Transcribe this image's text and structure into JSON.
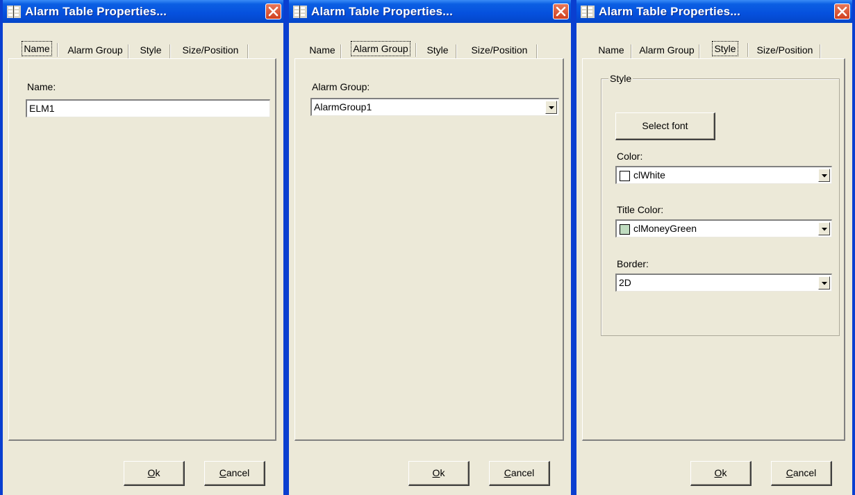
{
  "windows": [
    {
      "title": "Alarm Table Properties...",
      "tabs": [
        {
          "label": "Name"
        },
        {
          "label": "Alarm Group"
        },
        {
          "label": "Style"
        },
        {
          "label": "Size/Position"
        }
      ],
      "active_tab": "Name",
      "name_label": "Name:",
      "name_value": "ELM1",
      "ok_label": "Ok",
      "ok_mnemonic": "O",
      "cancel_label": "Cancel",
      "cancel_mnemonic": "C"
    },
    {
      "title": "Alarm Table Properties...",
      "tabs": [
        {
          "label": "Name"
        },
        {
          "label": "Alarm Group"
        },
        {
          "label": "Style"
        },
        {
          "label": "Size/Position"
        }
      ],
      "active_tab": "Alarm Group",
      "alarm_group_label": "Alarm Group:",
      "alarm_group_value": "AlarmGroup1",
      "ok_label": "Ok",
      "cancel_label": "Cancel"
    },
    {
      "title": "Alarm Table Properties...",
      "tabs": [
        {
          "label": "Name"
        },
        {
          "label": "Alarm Group"
        },
        {
          "label": "Style"
        },
        {
          "label": "Size/Position"
        }
      ],
      "active_tab": "Style",
      "group_title": "Style",
      "select_font_label": "Select font",
      "color_label": "Color:",
      "color_value": "clWhite",
      "color_swatch": "#ffffff",
      "title_color_label": "Title Color:",
      "title_color_value": "clMoneyGreen",
      "title_color_swatch": "#c0dcc0",
      "border_label": "Border:",
      "border_value": "2D",
      "ok_label": "Ok",
      "cancel_label": "Cancel"
    }
  ],
  "colors": {
    "titlebar": "#0550dd",
    "window_face": "#ece9d8",
    "close_button": "#d0401f"
  },
  "icons": [
    "app-icon",
    "close-icon",
    "dropdown-arrow-icon"
  ]
}
